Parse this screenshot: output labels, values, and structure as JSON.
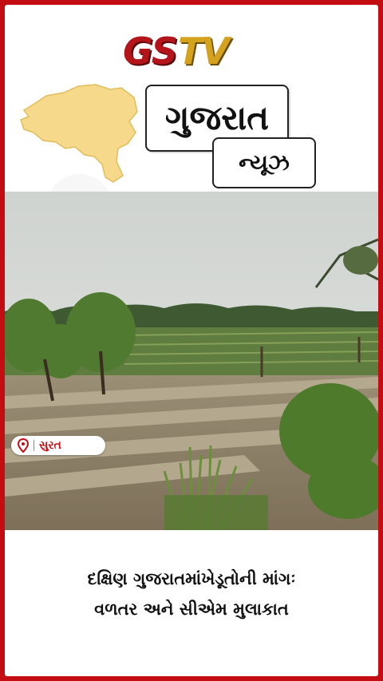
{
  "brand": {
    "gs": "GS",
    "tv": "TV"
  },
  "title": "ગુજરાત",
  "subtitle": "ન્યૂઝ",
  "location": {
    "label": "સુરત"
  },
  "headline": {
    "line1": "દક્ષિણ ગુજરાતમાંખેડૂતોની માંગઃ",
    "line2": "વળતર અને સીએમ મુલાકાત"
  },
  "colors": {
    "brand_red": "#c40d12",
    "brand_gold": "#d4a21c",
    "map_fill": "#f6d98a"
  }
}
